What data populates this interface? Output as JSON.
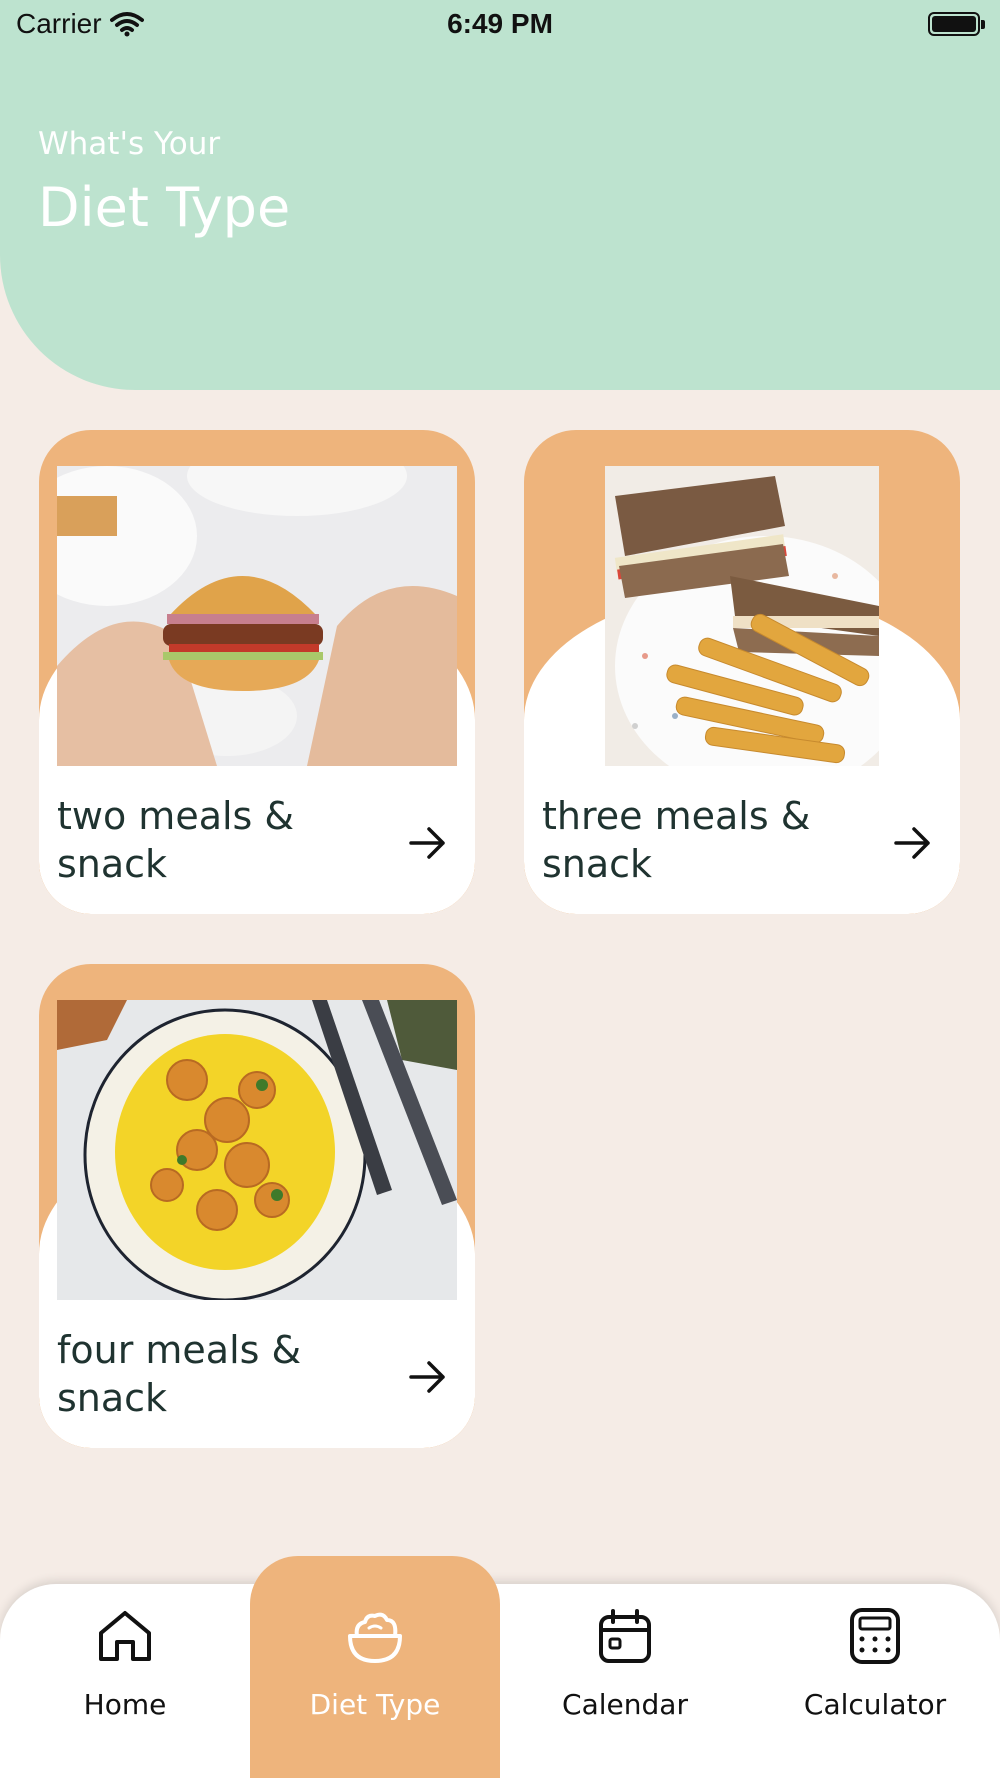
{
  "status_bar": {
    "carrier": "Carrier",
    "time": "6:49 PM"
  },
  "header": {
    "subtitle": "What's Your",
    "title": "Diet Type"
  },
  "cards": [
    {
      "label": "two meals & snack",
      "image": "burger-photo"
    },
    {
      "label": "three meals & snack",
      "image": "sandwich-fries-photo"
    },
    {
      "label": "four meals & snack",
      "image": "shrimp-rice-photo"
    }
  ],
  "tabs": [
    {
      "label": "Home",
      "icon": "home-icon"
    },
    {
      "label": "Diet Type",
      "icon": "bowl-icon",
      "active": true
    },
    {
      "label": "Calendar",
      "icon": "calendar-icon"
    },
    {
      "label": "Calculator",
      "icon": "calculator-icon"
    }
  ],
  "colors": {
    "header_green": "#bde3cf",
    "background": "#f5ece6",
    "accent_orange": "#eeb47c",
    "text_dark": "#1f3330"
  }
}
